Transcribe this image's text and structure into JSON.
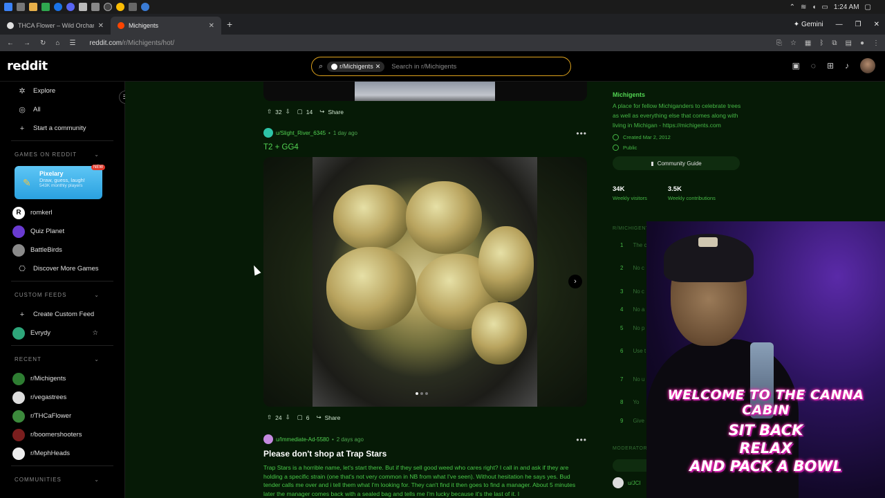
{
  "system": {
    "clock": "1:24 AM",
    "colors": {
      "taskbar": "#1b1b1b",
      "feed_bg": "#061a06",
      "accent_green": "#52d352",
      "search_border": "#e0a41c"
    }
  },
  "browser": {
    "tabs": [
      {
        "title": "THCA Flower – Wild Orchard H",
        "icon": "orchard-favicon"
      },
      {
        "title": "Michigents",
        "icon": "reddit-favicon"
      }
    ],
    "new_tab": "+",
    "gemini_label": "Gemini",
    "url_host": "reddit.com",
    "url_path": "/r/Michigents/hot/"
  },
  "header": {
    "logo": "reddit",
    "search_chip": "r/Michigents",
    "search_placeholder": "Search in r/Michigents"
  },
  "sidebar": {
    "top_items": [
      {
        "label": "Explore",
        "icon": "explore-icon"
      },
      {
        "label": "All",
        "icon": "all-icon"
      },
      {
        "label": "Start a community",
        "icon": "plus-icon"
      }
    ],
    "games_header": "GAMES ON REDDIT",
    "featured_game": {
      "title": "Pixelary",
      "subtitle": "Draw, guess, laugh!",
      "meta": "543K monthly players",
      "badge": "NEW"
    },
    "games": [
      "romkerl",
      "Quiz Planet",
      "BattleBirds",
      "Discover More Games"
    ],
    "custom_feeds_header": "CUSTOM FEEDS",
    "custom_feeds": [
      "Create Custom Feed",
      "Evrydy"
    ],
    "recent_header": "RECENT",
    "recent": [
      "r/Michigents",
      "r/vegastrees",
      "r/THCaFlower",
      "r/boomershooters",
      "r/MephHeads"
    ],
    "communities_header": "COMMUNITIES"
  },
  "feed": {
    "prev_post": {
      "votes": "32",
      "comments": "14",
      "share": "Share"
    },
    "post1": {
      "user": "u/Slight_River_6345",
      "time": "1 day ago",
      "title": "T2 + GG4",
      "votes": "24",
      "comments": "6",
      "share": "Share"
    },
    "post2": {
      "user": "u/Immediate-Ad-5580",
      "time": "2 days ago",
      "title": "Please don't shop at Trap Stars",
      "body": "Trap Stars is a horrible name, let's start there. But if they sell good weed who cares right? I call in and ask if they are holding a specific strain (one that's not very common in NB from what I've seen). Without hesitation he says yes. Bud tender calls me over and i tell them what I'm looking for. They can't find it then goes to find a manager. About 5 minutes later the manager comes back with a sealed bag and tells me I'm lucky because it's the last of it. I"
    }
  },
  "right_sidebar": {
    "name": "Michigents",
    "description": "A place for fellow Michiganders to celebrate trees as well as everything else that comes along with living in Michigan - https://michigents.com",
    "created": "Created Mar 2, 2012",
    "visibility": "Public",
    "guide_button": "Community Guide",
    "stats": [
      {
        "value": "34K",
        "label": "Weekly visitors"
      },
      {
        "value": "3.5K",
        "label": "Weekly contributions"
      }
    ],
    "rules_header": "R/MICHIGENTS RULES",
    "rules": [
      {
        "n": "1",
        "text": "The c"
      },
      {
        "n": "2",
        "text": "No c"
      },
      {
        "n": "3",
        "text": "No c"
      },
      {
        "n": "4",
        "text": "No a"
      },
      {
        "n": "5",
        "text": "No p"
      },
      {
        "n": "6",
        "text": "Use t"
      },
      {
        "n": "7",
        "text": "No u"
      },
      {
        "n": "8",
        "text": "Yo"
      },
      {
        "n": "9",
        "text": "Give"
      }
    ],
    "moderators_header": "MODERATORS",
    "mod_user": "u/JCI"
  },
  "stream_overlay": {
    "line1": "WELCOME TO THE CANNA CABIN",
    "line2": "SIT BACK",
    "line3": "RELAX",
    "line4": "AND PACK A BOWL"
  }
}
